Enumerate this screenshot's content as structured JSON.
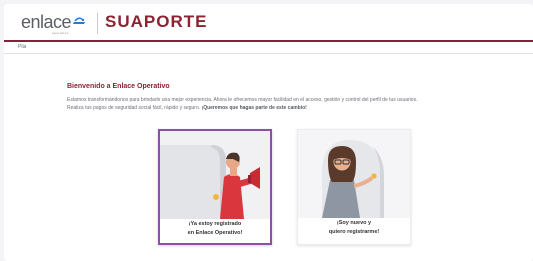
{
  "header": {
    "brand_left": "enlace",
    "brand_left_tagline": "operativo",
    "brand_right": "SUAPORTE"
  },
  "breadcrumb": "Pila",
  "main": {
    "title": "Bienvenido a Enlace Operativo",
    "description_line1": "Estamos transformándonos para brindarle una mejor experiencia. Ahora le ofrecemos mayor facilidad en el acceso, gestión y control del perfil de tus usuarios.",
    "description_line2": "Realiza tus pagos de seguridad social fácil, rápido y seguro. ",
    "description_emphasis": "¡Queremos que hagas parte de este cambio!"
  },
  "cards": [
    {
      "line1": "¡Ya estoy registrado",
      "line2": "en Enlace Operativo!"
    },
    {
      "line1": "¡Soy nuevo y",
      "line2": "quiero registrarme!"
    }
  ],
  "colors": {
    "brand": "#8b2332",
    "accent_border": "#8e4fa6",
    "header_rule": "#8a1f3a"
  }
}
